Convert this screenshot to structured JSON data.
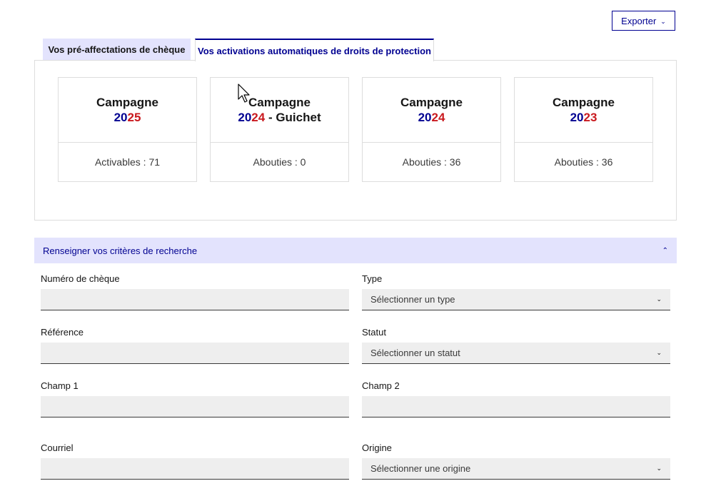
{
  "toolbar": {
    "export_label": "Exporter"
  },
  "tabs": [
    {
      "label": "Vos pré-affectations de chèque"
    },
    {
      "label": "Vos activations automatiques de droits de protection"
    }
  ],
  "cards": [
    {
      "title": "Campagne",
      "year_start": "20",
      "year_end": "25",
      "suffix": "",
      "stat": "Activables : 71"
    },
    {
      "title": "Campagne",
      "year_start": "20",
      "year_end": "24",
      "suffix": " - Guichet",
      "stat": "Abouties : 0"
    },
    {
      "title": "Campagne",
      "year_start": "20",
      "year_end": "24",
      "suffix": "",
      "stat": "Abouties : 36"
    },
    {
      "title": "Campagne",
      "year_start": "20",
      "year_end": "23",
      "suffix": "",
      "stat": "Abouties : 36"
    }
  ],
  "search": {
    "header": "Renseigner vos critères de recherche",
    "fields": {
      "cheque_number": {
        "label": "Numéro de chèque",
        "value": ""
      },
      "type": {
        "label": "Type",
        "value": "Sélectionner un type"
      },
      "reference": {
        "label": "Référence",
        "value": ""
      },
      "status": {
        "label": "Statut",
        "value": "Sélectionner un statut"
      },
      "field1": {
        "label": "Champ 1",
        "value": ""
      },
      "field2": {
        "label": "Champ 2",
        "value": ""
      },
      "email": {
        "label": "Courriel",
        "value": ""
      },
      "origin": {
        "label": "Origine",
        "value": "Sélectionner une origine"
      }
    }
  },
  "colors": {
    "primary": "#000091",
    "accent_red": "#c9191e",
    "tab_bg": "#e3e3fd",
    "input_bg": "#eeeeee"
  }
}
